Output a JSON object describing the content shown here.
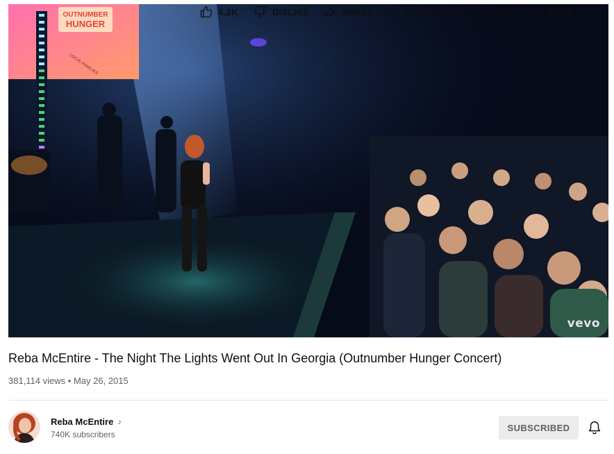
{
  "player": {
    "watermark": "vevo",
    "screen_text": [
      "OUTNUMBER",
      "HUNGER",
      "LOCAL FAMILIES"
    ]
  },
  "video": {
    "title": "Reba McEntire - The Night The Lights Went Out In Georgia (Outnumber Hunger Concert)",
    "views": "381,114 views",
    "separator": "•",
    "date": "May 26, 2015"
  },
  "actions": {
    "like_count": "4.2K",
    "dislike_label": "DISLIKE",
    "share_label": "SHARE",
    "download_label": "DOWNLOAD",
    "clip_label": "CLIP",
    "save_label": "SAVE",
    "more_icon": "more-horizontal-icon"
  },
  "channel": {
    "name": "Reba McEntire",
    "badge_icon": "music-note-icon",
    "subscribers": "740K subscribers",
    "subscribe_state_label": "SUBSCRIBED"
  },
  "colors": {
    "text_primary": "#0f0f0f",
    "text_secondary": "#606060",
    "button_bg": "#ececec",
    "divider": "#e5e5e5"
  }
}
